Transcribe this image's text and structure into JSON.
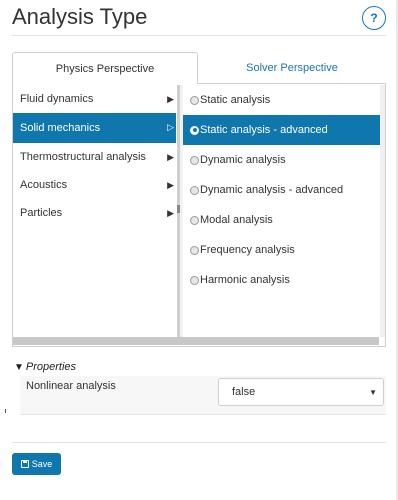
{
  "header": {
    "title": "Analysis Type",
    "help_label": "?"
  },
  "tabs": [
    {
      "label": "Physics Perspective",
      "active": true
    },
    {
      "label": "Solver Perspective",
      "active": false
    }
  ],
  "categories": [
    {
      "label": "Fluid dynamics",
      "selected": false
    },
    {
      "label": "Solid mechanics",
      "selected": true
    },
    {
      "label": "Thermostructural analysis",
      "selected": false
    },
    {
      "label": "Acoustics",
      "selected": false
    },
    {
      "label": "Particles",
      "selected": false
    }
  ],
  "analyses": [
    {
      "label": "Static analysis",
      "selected": false
    },
    {
      "label": "Static analysis - advanced",
      "selected": true
    },
    {
      "label": "Dynamic analysis",
      "selected": false
    },
    {
      "label": "Dynamic analysis - advanced",
      "selected": false
    },
    {
      "label": "Modal analysis",
      "selected": false
    },
    {
      "label": "Frequency analysis",
      "selected": false
    },
    {
      "label": "Harmonic analysis",
      "selected": false
    }
  ],
  "properties": {
    "header": "Properties",
    "items": [
      {
        "label": "Nonlinear analysis",
        "value": "false"
      }
    ]
  },
  "footer": {
    "save_label": "Save"
  },
  "colors": {
    "accent": "#0f76ae",
    "link": "#1a75bb"
  }
}
